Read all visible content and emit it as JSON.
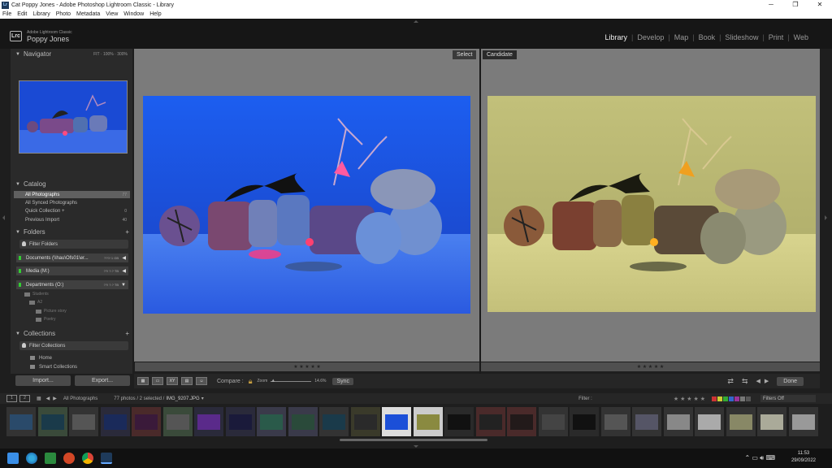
{
  "window": {
    "title": "Cat Poppy Jones - Adobe Photoshop Lightroom Classic - Library"
  },
  "menu": [
    "File",
    "Edit",
    "Library",
    "Photo",
    "Metadata",
    "View",
    "Window",
    "Help"
  ],
  "identity": {
    "product": "Adobe Lightroom Classic",
    "user": "Poppy Jones",
    "logo": "Lrc"
  },
  "modules": [
    "Library",
    "Develop",
    "Map",
    "Book",
    "Slideshow",
    "Print",
    "Web"
  ],
  "active_module": "Library",
  "navigator": {
    "title": "Navigator",
    "fit": "FIT",
    "z1": "100%",
    "z2": "300%"
  },
  "catalog": {
    "title": "Catalog",
    "items": [
      {
        "label": "All Photographs",
        "count": "77"
      },
      {
        "label": "All Synced Photographs",
        "count": ""
      },
      {
        "label": "Quick Collection +",
        "count": "0"
      },
      {
        "label": "Previous Import",
        "count": "40"
      }
    ]
  },
  "folders": {
    "title": "Folders",
    "filter": "Filter Folders",
    "volumes": [
      {
        "name": "Documents (\\\\hau\\Ofs01\\er...",
        "size": "???/ 1 GB"
      },
      {
        "name": "Media (M:)",
        "size": "??/ ?.? TB"
      },
      {
        "name": "Departments (O:)",
        "size": "??/ ?.? TB"
      }
    ],
    "subfolders": [
      "Students",
      "A2",
      "Picture story",
      "Poetry"
    ]
  },
  "collections": {
    "title": "Collections",
    "filter": "Filter Collections",
    "items": [
      "Home",
      "Smart Collections"
    ]
  },
  "buttons": {
    "import": "Import...",
    "export": "Export..."
  },
  "compare": {
    "select": "Select",
    "candidate": "Candidate",
    "label": "Compare :",
    "zoom_label": "Zoom",
    "zoom_value": "14.6%",
    "sync": "Sync",
    "done": "Done"
  },
  "stars": "★ ★ ★ ★ ★",
  "filmstrip": {
    "source": "All Photographs",
    "info": "77 photos / 2 selected /",
    "filename": "IMG_9207.JPG",
    "filter_label": "Filter :",
    "filter_value": "Filters Off"
  },
  "clock": {
    "time": "11:53",
    "date": "29/09/2022"
  },
  "colors": {
    "accent": "#1b4fd8",
    "candidate_bg": "#c2c07a"
  }
}
